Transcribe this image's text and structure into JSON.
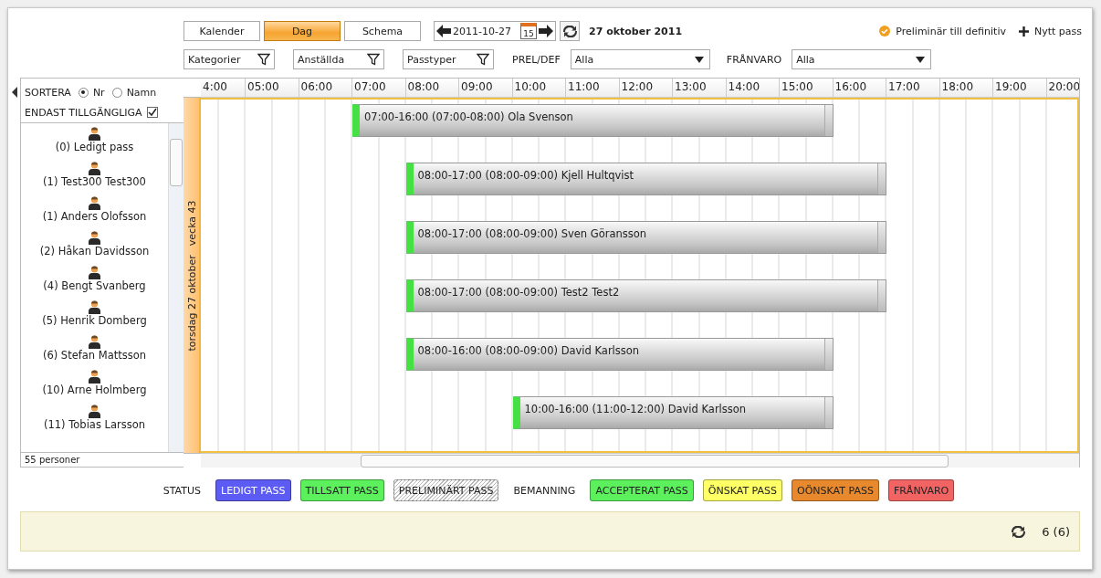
{
  "view_tabs": [
    {
      "label": "Kalender",
      "selected": false
    },
    {
      "label": "Dag",
      "selected": true
    },
    {
      "label": "Schema",
      "selected": false
    }
  ],
  "date_nav": {
    "date": "2011-10-27",
    "calendar_day": "15",
    "title": "27 oktober 2011"
  },
  "actions": [
    {
      "kind": "check",
      "label": "Preliminär till definitiv"
    },
    {
      "kind": "plus",
      "label": "Nytt pass"
    }
  ],
  "filters": [
    {
      "label": "Kategorier"
    },
    {
      "label": "Anställda"
    },
    {
      "label": "Passtyper"
    }
  ],
  "dropdowns": [
    {
      "label": "PREL/DEF",
      "value": "Alla"
    },
    {
      "label": "FRÅNVARO",
      "value": "Alla"
    }
  ],
  "sidebar": {
    "sort_label": "SORTERA",
    "sort_options": [
      {
        "label": "Nr",
        "selected": true
      },
      {
        "label": "Namn",
        "selected": false
      }
    ],
    "only_available": {
      "label": "ENDAST TILLGÄNGLIGA",
      "checked": true
    },
    "people": [
      "(0) Ledigt pass",
      "(1) Test300 Test300",
      "(1) Anders Olofsson",
      "(2) Håkan Davidsson",
      "(4) Bengt Svanberg",
      "(5) Henrik Domberg",
      "(6) Stefan Mattsson",
      "(10) Arne Holmberg",
      "(11) Tobias Larsson"
    ],
    "count": "55 personer"
  },
  "timeline": {
    "day": "torsdag 27 oktober",
    "week": "vecka 43",
    "hours": [
      "4:00",
      "05:00",
      "06:00",
      "07:00",
      "08:00",
      "09:00",
      "10:00",
      "11:00",
      "12:00",
      "13:00",
      "14:00",
      "15:00",
      "16:00",
      "17:00",
      "18:00",
      "19:00",
      "20:00"
    ],
    "shifts": [
      {
        "time": "07:00-16:00",
        "break": "(07:00-08:00)",
        "name": "Ola Svenson"
      },
      {
        "time": "08:00-17:00",
        "break": "(08:00-09:00)",
        "name": "Kjell Hultqvist"
      },
      {
        "time": "08:00-17:00",
        "break": "(08:00-09:00)",
        "name": "Sven Göransson"
      },
      {
        "time": "08:00-17:00",
        "break": "(08:00-09:00)",
        "name": "Test2 Test2"
      },
      {
        "time": "08:00-16:00",
        "break": "(08:00-09:00)",
        "name": "David Karlsson"
      },
      {
        "time": "10:00-16:00",
        "break": "(11:00-12:00)",
        "name": "David Karlsson"
      }
    ]
  },
  "legend": {
    "status_label": "STATUS",
    "status": [
      {
        "label": "LEDIGT PASS",
        "kind": "solid",
        "color": "#5c5cf4"
      },
      {
        "label": "TILLSATT PASS",
        "kind": "solid",
        "color": "#5cf05c"
      },
      {
        "label": "PRELIMINÄRT PASS",
        "kind": "hatched"
      }
    ],
    "staffing_label": "BEMANNING",
    "staffing": [
      {
        "label": "ACCEPTERAT PASS",
        "kind": "solid",
        "color": "#5cf05c"
      },
      {
        "label": "ÖNSKAT PASS",
        "kind": "solid",
        "color": "#ffff66"
      },
      {
        "label": "OÖNSKAT PASS",
        "kind": "solid",
        "color": "#e8892e"
      },
      {
        "label": "FRÅNVARO",
        "kind": "solid",
        "color": "#f26464"
      }
    ]
  },
  "footer": {
    "count": "6 (6)"
  }
}
